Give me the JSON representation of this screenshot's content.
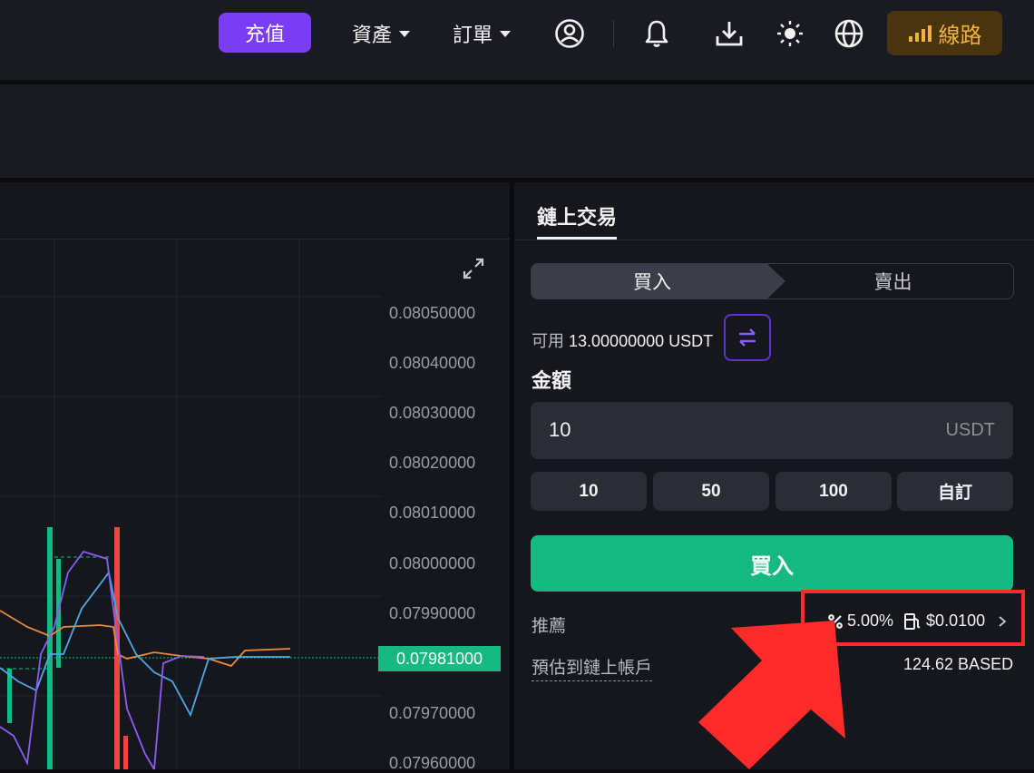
{
  "header": {
    "deposit_label": "充值",
    "assets_label": "資產",
    "orders_label": "訂單",
    "route_label": "線路"
  },
  "chart": {
    "price_ticks": [
      "0.08050000",
      "0.08040000",
      "0.08030000",
      "0.08020000",
      "0.08010000",
      "0.08000000",
      "0.07990000",
      "0.07970000",
      "0.07960000"
    ],
    "current_price": "0.07981000"
  },
  "trade": {
    "tab_label": "鏈上交易",
    "buy_tab": "買入",
    "sell_tab": "賣出",
    "available_prefix": "可用",
    "available_value": "13.00000000 USDT",
    "amount_label": "金額",
    "amount_value": "10",
    "amount_unit": "USDT",
    "quick_amounts": [
      "10",
      "50",
      "100",
      "自訂"
    ],
    "buy_button": "買入",
    "recommend_label": "推薦",
    "slippage": "5.00%",
    "gas_fee": "$0.0100",
    "estimate_label": "預估到鏈上帳戶",
    "estimate_value": "124.62 BASED"
  },
  "colors": {
    "accent_purple": "#7b3cf6",
    "buy_green": "#16b981",
    "sell_red": "#ef4444",
    "route_gold": "#f1b23c",
    "annotation_red": "#ff2b2b"
  }
}
